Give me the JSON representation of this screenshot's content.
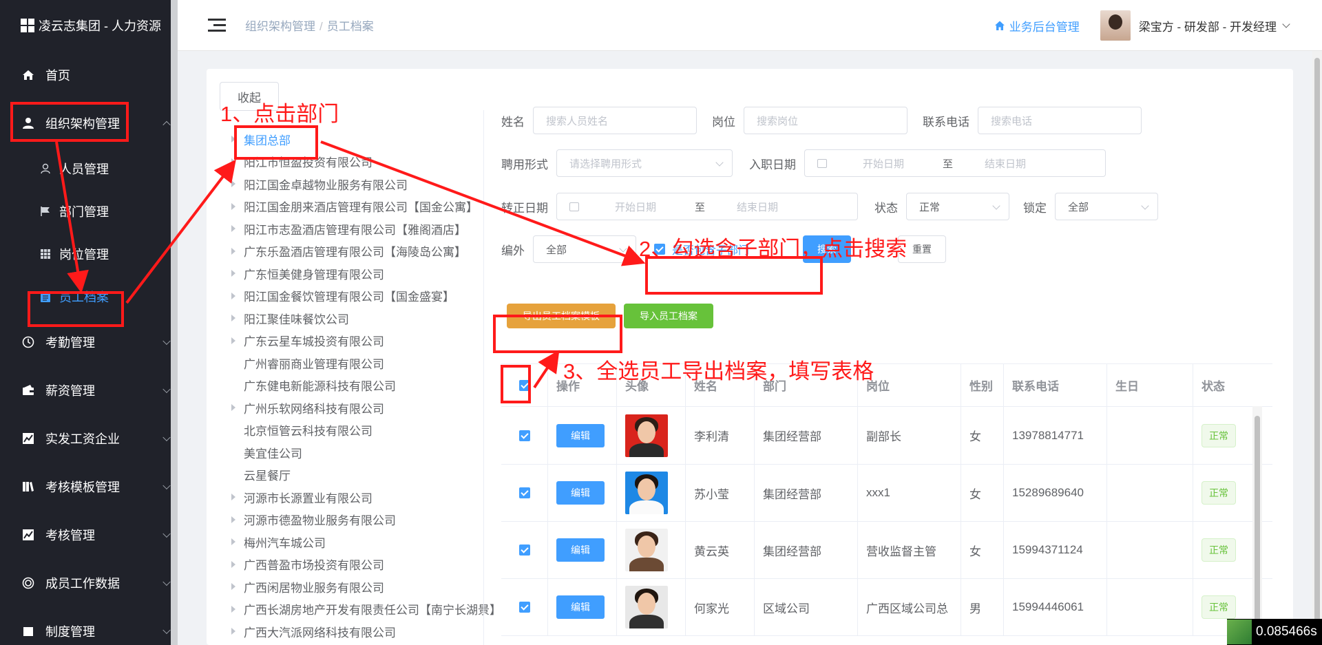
{
  "sidebar": {
    "brand": "凌云志集团 - 人力资源",
    "items": [
      {
        "label": "首页",
        "icon": "home-icon"
      },
      {
        "label": "组织架构管理",
        "icon": "user-icon"
      },
      {
        "label": "考勤管理",
        "icon": "clock-icon"
      },
      {
        "label": "薪资管理",
        "icon": "wallet-icon"
      },
      {
        "label": "实发工资企业",
        "icon": "chart-icon"
      },
      {
        "label": "考核模板管理",
        "icon": "book-icon"
      },
      {
        "label": "考核管理",
        "icon": "chart-icon"
      },
      {
        "label": "成员工作数据",
        "icon": "target-icon"
      },
      {
        "label": "制度管理",
        "icon": "doc-icon"
      }
    ],
    "sub_items": [
      {
        "label": "人员管理",
        "icon": "person-icon"
      },
      {
        "label": "部门管理",
        "icon": "flag-icon"
      },
      {
        "label": "岗位管理",
        "icon": "grid-icon"
      },
      {
        "label": "员工档案",
        "icon": "clipboard-icon"
      }
    ]
  },
  "header": {
    "breadcrumb": [
      "组织架构管理",
      "员工档案"
    ],
    "backend_link": "业务后台管理",
    "user": "梁宝方 - 研发部 - 开发经理"
  },
  "collapse_label": "收起",
  "tree": [
    {
      "label": "集团总部",
      "arrow": true,
      "selected": true
    },
    {
      "label": "阳江市恒盈投资有限公司",
      "arrow": true
    },
    {
      "label": "阳江国金卓越物业服务有限公司",
      "arrow": true
    },
    {
      "label": "阳江国金朋来酒店管理有限公司【国金公寓】",
      "arrow": true
    },
    {
      "label": "阳江市志盈酒店管理有限公司【雅阁酒店】",
      "arrow": true
    },
    {
      "label": "广东乐盈酒店管理有限公司【海陵岛公寓】",
      "arrow": true
    },
    {
      "label": "广东恒美健身管理有限公司",
      "arrow": true
    },
    {
      "label": "阳江国金餐饮管理有限公司【国金盛宴】",
      "arrow": true
    },
    {
      "label": "阳江聚佳味餐饮公司",
      "arrow": true
    },
    {
      "label": "广东云星车城投资有限公司",
      "arrow": true
    },
    {
      "label": "广州睿丽商业管理有限公司",
      "arrow": false
    },
    {
      "label": "广东健电新能源科技有限公司",
      "arrow": false
    },
    {
      "label": "广州乐软网络科技有限公司",
      "arrow": true
    },
    {
      "label": "北京恒管云科技有限公司",
      "arrow": false
    },
    {
      "label": "美宜佳公司",
      "arrow": false
    },
    {
      "label": "云星餐厅",
      "arrow": false
    },
    {
      "label": "河源市长源置业有限公司",
      "arrow": true
    },
    {
      "label": "河源市德盈物业服务有限公司",
      "arrow": true
    },
    {
      "label": "梅州汽车城公司",
      "arrow": true
    },
    {
      "label": "广西普盈市场投资有限公司",
      "arrow": true
    },
    {
      "label": "广西闲居物业服务有限公司",
      "arrow": true
    },
    {
      "label": "广西长湖房地产开发有限责任公司【南宁长湖景】",
      "arrow": true
    },
    {
      "label": "广西大汽派网络科技有限公司",
      "arrow": true
    }
  ],
  "form": {
    "name_label": "姓名",
    "name_ph": "搜索人员姓名",
    "post_label": "岗位",
    "post_ph": "搜索岗位",
    "phone_label": "联系电话",
    "phone_ph": "搜索电话",
    "hire_label": "聘用形式",
    "hire_ph": "请选择聘用形式",
    "entry_label": "入职日期",
    "regular_label": "转正日期",
    "start_ph": "开始日期",
    "to": "至",
    "end_ph": "结束日期",
    "status_label": "状态",
    "status_val": "正常",
    "lock_label": "锁定",
    "lock_val": "全部",
    "outside_label": "编外",
    "outside_val": "全部",
    "include_sub": "是否包含子部门",
    "search": "搜索",
    "reset": "重置",
    "export": "导出员工档案模板",
    "import": "导入员工档案"
  },
  "table": {
    "headers": [
      "操作",
      "头像",
      "姓名",
      "部门",
      "岗位",
      "性别",
      "联系电话",
      "生日",
      "状态"
    ],
    "edit_label": "编辑",
    "rows": [
      {
        "name": "李利清",
        "dept": "集团经营部",
        "post": "副部长",
        "gender": "女",
        "phone": "13978814771",
        "birthday": "",
        "status": "正常"
      },
      {
        "name": "苏小莹",
        "dept": "集团经营部",
        "post": "xxx1",
        "gender": "女",
        "phone": "15289689640",
        "birthday": "",
        "status": "正常"
      },
      {
        "name": "黄云英",
        "dept": "集团经营部",
        "post": "营收监督主管",
        "gender": "女",
        "phone": "15994371124",
        "birthday": "",
        "status": "正常"
      },
      {
        "name": "何家光",
        "dept": "区域公司",
        "post": "广西区域公司总",
        "gender": "男",
        "phone": "15994446061",
        "birthday": "",
        "status": "正常"
      }
    ]
  },
  "annotations": {
    "step1": "1、点击部门",
    "step2": "2、勾选含子部门，点击搜索",
    "step3": "3、全选员工导出档案，填写表格"
  },
  "timer": "0.085466s",
  "colors": {
    "primary": "#409eff",
    "sidebar": "#20222a",
    "annotation": "#ff1a1a",
    "warning": "#e6a23c",
    "success": "#67c23a"
  }
}
